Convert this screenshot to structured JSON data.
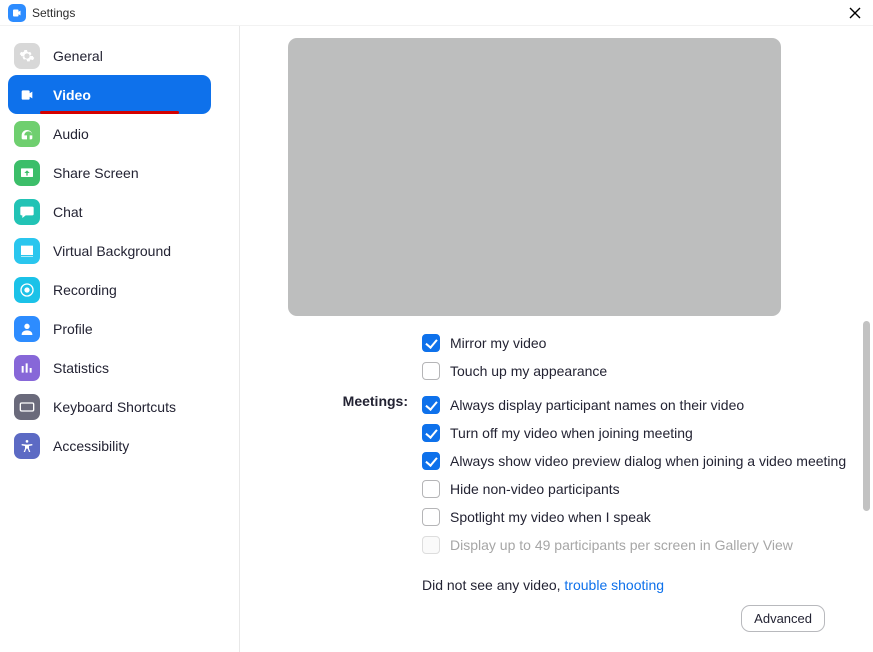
{
  "title": "Settings",
  "sidebar": {
    "items": [
      {
        "label": "General",
        "icon": "gear",
        "bg": "#d8d8d8"
      },
      {
        "label": "Video",
        "icon": "video",
        "bg": "#ffffff",
        "active": true
      },
      {
        "label": "Audio",
        "icon": "audio",
        "bg": "#6FCF6F"
      },
      {
        "label": "Share Screen",
        "icon": "share",
        "bg": "#3CBE69"
      },
      {
        "label": "Chat",
        "icon": "chat",
        "bg": "#22C3B5"
      },
      {
        "label": "Virtual Background",
        "icon": "virtualbg",
        "bg": "#2AC6EE"
      },
      {
        "label": "Recording",
        "icon": "recording",
        "bg": "#1BC2E8"
      },
      {
        "label": "Profile",
        "icon": "profile",
        "bg": "#2D8CFF"
      },
      {
        "label": "Statistics",
        "icon": "statistics",
        "bg": "#8767D8"
      },
      {
        "label": "Keyboard Shortcuts",
        "icon": "keyboard",
        "bg": "#6A6A7B"
      },
      {
        "label": "Accessibility",
        "icon": "accessibility",
        "bg": "#5C6AC4"
      }
    ]
  },
  "main": {
    "partial_option": {
      "label": "Mirror my video",
      "checked": true
    },
    "touchup_option": {
      "label": "Touch up my appearance",
      "checked": false
    },
    "meetings_label": "Meetings:",
    "meeting_options": [
      {
        "label": "Always display participant names on their video",
        "checked": true,
        "disabled": false
      },
      {
        "label": "Turn off my video when joining meeting",
        "checked": true,
        "disabled": false
      },
      {
        "label": "Always show video preview dialog when joining a video meeting",
        "checked": true,
        "disabled": false
      },
      {
        "label": "Hide non-video participants",
        "checked": false,
        "disabled": false
      },
      {
        "label": "Spotlight my video when I speak",
        "checked": false,
        "disabled": false
      },
      {
        "label": "Display up to 49 participants per screen in Gallery View",
        "checked": false,
        "disabled": true
      }
    ],
    "hint_prefix": "Did not see any video,  ",
    "hint_link": "trouble shooting",
    "advanced_label": "Advanced"
  }
}
